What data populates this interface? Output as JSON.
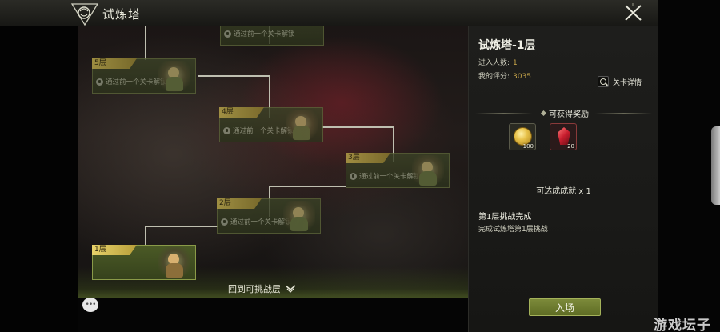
{
  "header": {
    "title": "试炼塔"
  },
  "map": {
    "lock_text": "通过前一个关卡解锁",
    "floors": [
      {
        "label": "",
        "locked": true
      },
      {
        "label": "5层",
        "locked": true
      },
      {
        "label": "4层",
        "locked": true
      },
      {
        "label": "3层",
        "locked": true
      },
      {
        "label": "2层",
        "locked": true
      },
      {
        "label": "1层",
        "locked": false
      }
    ],
    "back_label": "回到可挑战层"
  },
  "info": {
    "title": "试炼塔-1层",
    "players_label": "进入人数:",
    "players_value": "1",
    "rating_label": "我的评分:",
    "rating_value": "3035",
    "detail_label": "关卡详情",
    "rewards_header": "可获得奖励",
    "rewards": [
      {
        "icon": "gold-coin-icon",
        "count": "100"
      },
      {
        "icon": "red-gem-icon",
        "count": "20"
      }
    ],
    "achievement_header": "可达成成就 x 1",
    "achievement_title": "第1层挑战完成",
    "achievement_desc": "完成试炼塔第1层挑战",
    "enter_label": "入场"
  },
  "watermark": "游戏坛子",
  "colors": {
    "accent_gold": "#c8a64a",
    "panel_green": "#3b4226",
    "button_green": "#6e7c2e"
  }
}
